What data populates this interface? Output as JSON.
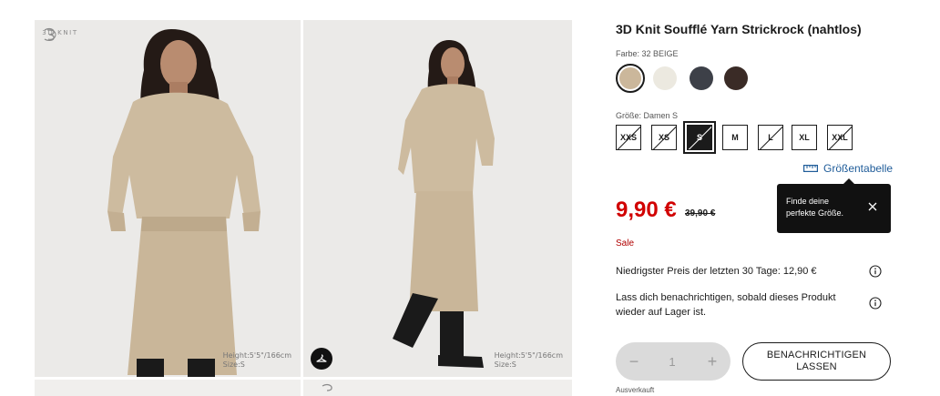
{
  "gallery": {
    "badge_text": "3D KNIT",
    "images": [
      {
        "alt": "Model in beige knit sweater and skirt, front view",
        "height_info": "Height:5'5\"/166cm",
        "size_info": "Size:S"
      },
      {
        "alt": "Model in beige knit sweater and skirt walking",
        "height_info": "Height:5'5\"/166cm",
        "size_info": "Size:S"
      }
    ]
  },
  "product": {
    "title": "3D Knit Soufflé Yarn Strickrock (nahtlos)",
    "color_label": "Farbe: 32 BEIGE",
    "colors": [
      {
        "name": "32 BEIGE",
        "hex": "#cbb79b",
        "selected": true
      },
      {
        "name": "Off White",
        "hex": "#ece9e0",
        "selected": false
      },
      {
        "name": "Dark Gray",
        "hex": "#3d4048",
        "selected": false
      },
      {
        "name": "Dark Brown",
        "hex": "#3a2b26",
        "selected": false
      }
    ],
    "size_label": "Größe: Damen S",
    "sizes": [
      {
        "label": "XXS",
        "unavailable": true,
        "selected": false
      },
      {
        "label": "XS",
        "unavailable": true,
        "selected": false
      },
      {
        "label": "S",
        "unavailable": true,
        "selected": true
      },
      {
        "label": "M",
        "unavailable": false,
        "selected": false
      },
      {
        "label": "L",
        "unavailable": true,
        "selected": false
      },
      {
        "label": "XL",
        "unavailable": false,
        "selected": false
      },
      {
        "label": "XXL",
        "unavailable": true,
        "selected": false
      }
    ],
    "size_chart_label": "Größentabelle",
    "price": "9,90 €",
    "old_price": "39,90 €",
    "sale_label": "Sale",
    "lowest_price_text": "Niedrigster Preis der letzten 30 Tage: 12,90 €",
    "notify_info_text": "Lass dich benachrichtigen, sobald dieses Produkt wieder auf Lager ist.",
    "quantity": "1",
    "quantity_minus": "−",
    "quantity_plus": "+",
    "notify_button": "BENACHRICHTIGEN LASSEN",
    "sold_out_label": "Ausverkauft"
  },
  "tooltip": {
    "text": "Finde deine perfekte Größe."
  },
  "colors": {
    "sale_red": "#d10000",
    "link_blue": "#1f5c99",
    "tooltip_bg": "#111111"
  }
}
